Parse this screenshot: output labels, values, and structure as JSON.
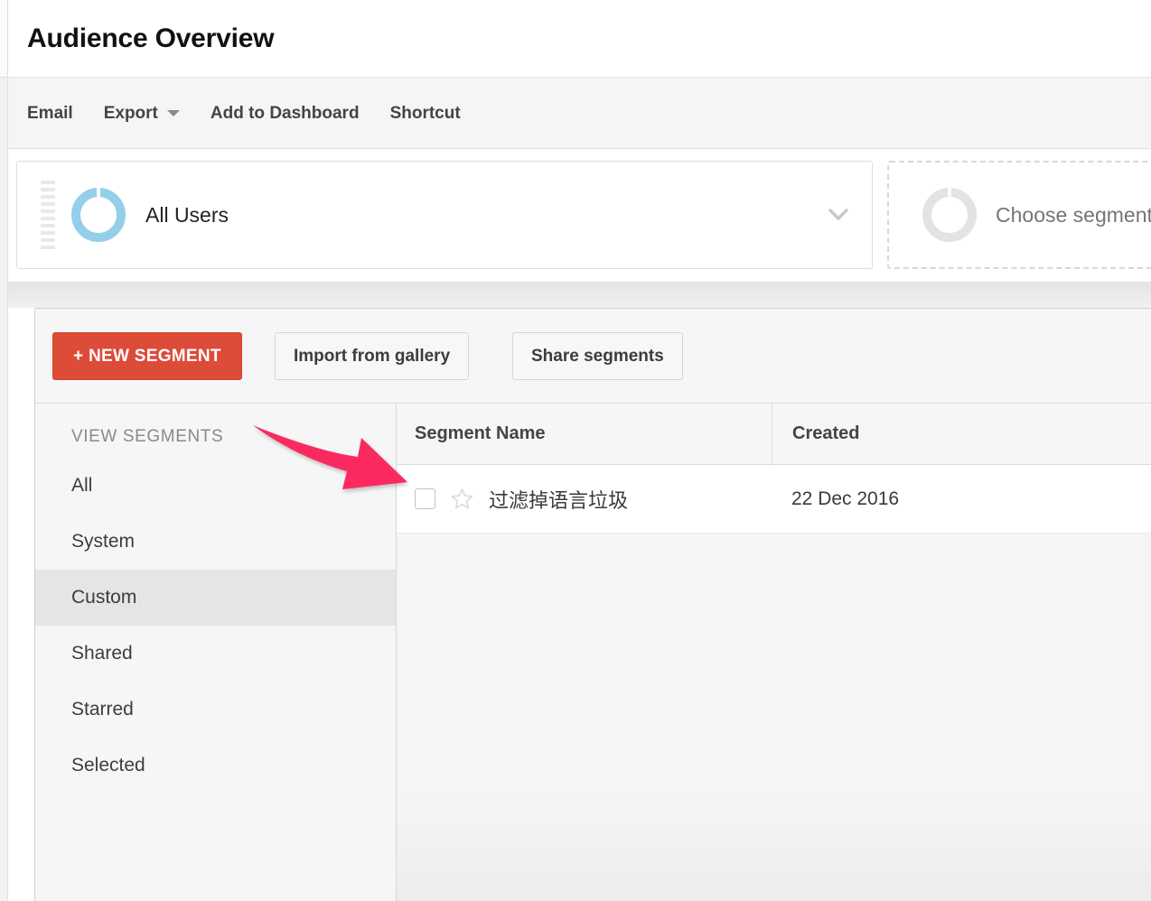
{
  "header": {
    "title": "Audience Overview"
  },
  "action_bar": {
    "items": [
      {
        "label": "Email",
        "icon": ""
      },
      {
        "label": "Export",
        "icon": "chevron-down-icon"
      },
      {
        "label": "Add to Dashboard",
        "icon": ""
      },
      {
        "label": "Shortcut",
        "icon": ""
      }
    ]
  },
  "segment_strip": {
    "applied_segment": {
      "label": "All Users",
      "icon": "segment-donut-icon",
      "donut_color": "#93cfe8",
      "drag_handle": "drag-handle-icon",
      "chevron": "chevron-down-icon"
    },
    "choose_segment": {
      "label": "Choose segment",
      "icon": "segment-donut-icon",
      "donut_color": "#e3e3e3"
    }
  },
  "segment_panel": {
    "toolbar": {
      "new_segment_label": "+ NEW SEGMENT",
      "new_segment_color": "#dd4b39",
      "import_label": "Import from gallery",
      "share_label": "Share segments"
    },
    "sidebar": {
      "heading": "VIEW SEGMENTS",
      "items": [
        {
          "label": "All",
          "active": false
        },
        {
          "label": "System",
          "active": false
        },
        {
          "label": "Custom",
          "active": true
        },
        {
          "label": "Shared",
          "active": false
        },
        {
          "label": "Starred",
          "active": false
        },
        {
          "label": "Selected",
          "active": false
        }
      ]
    },
    "table": {
      "columns": [
        {
          "key": "name",
          "label": "Segment Name"
        },
        {
          "key": "created",
          "label": "Created"
        }
      ],
      "rows": [
        {
          "checkbox": false,
          "starred": false,
          "name": "过滤掉语言垃圾",
          "created": "22 Dec 2016"
        }
      ]
    }
  },
  "annotation": {
    "arrow": {
      "name": "pointer-arrow",
      "color": "#fa2a60",
      "points_to": "segment-row-checkbox"
    }
  }
}
